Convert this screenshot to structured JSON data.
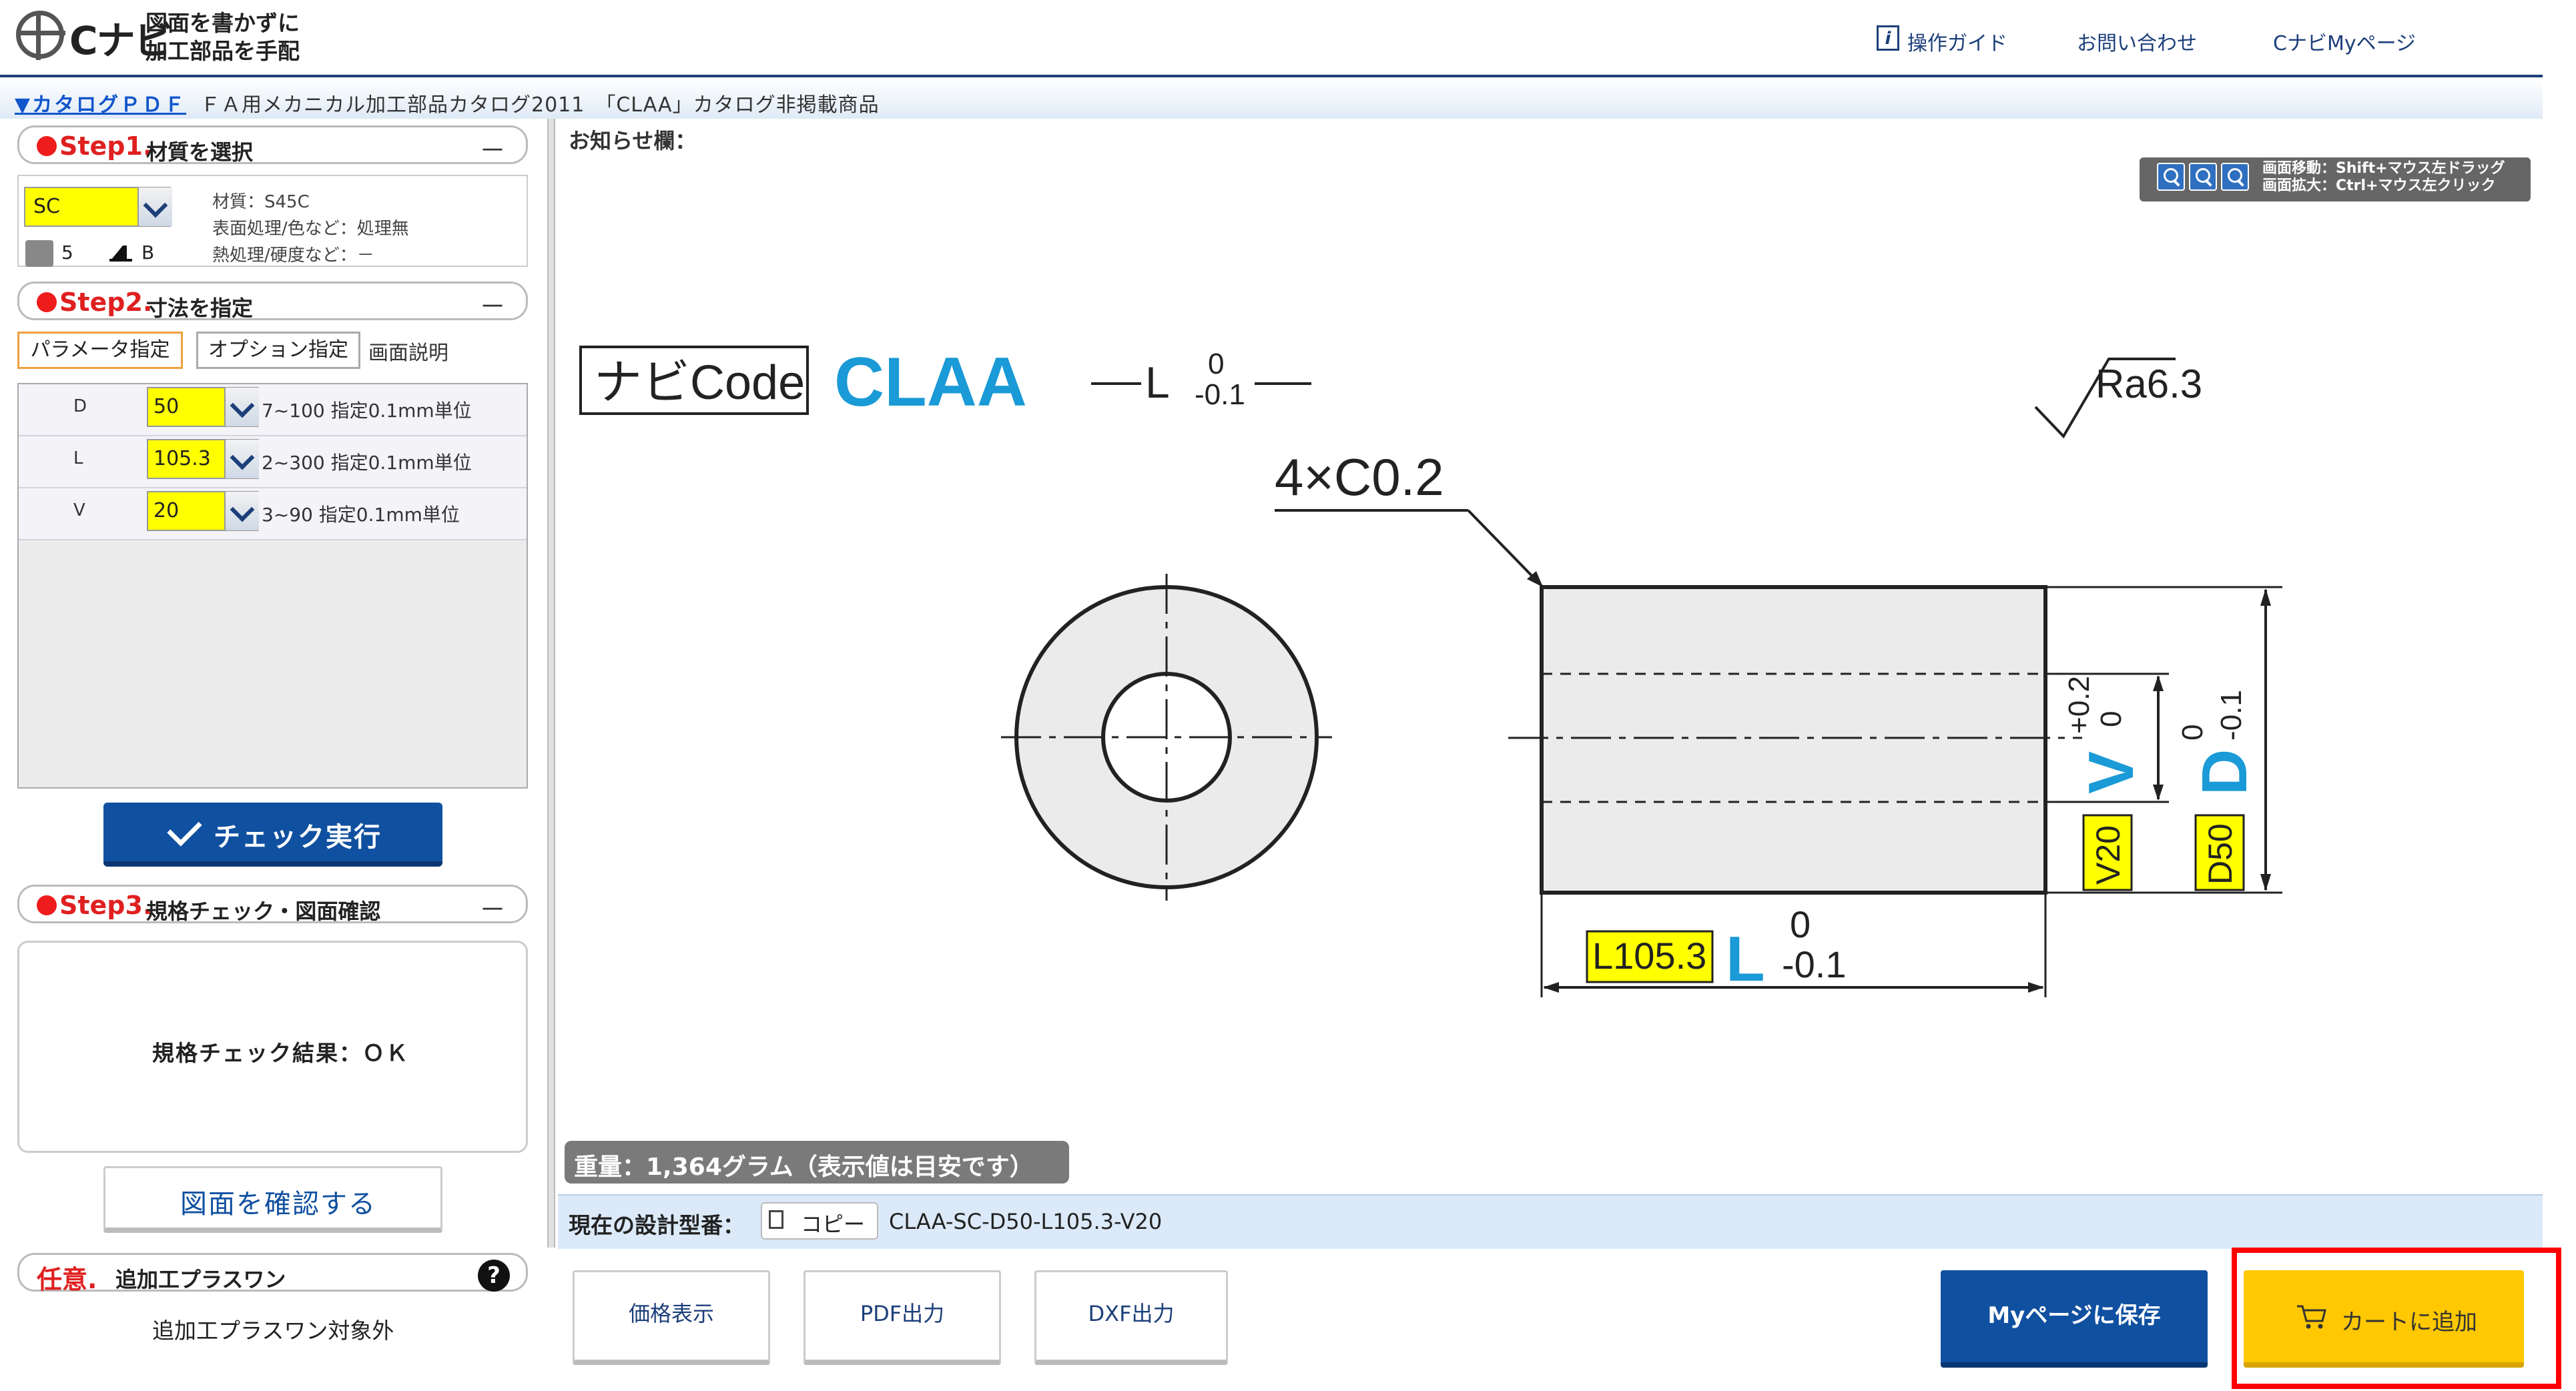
{
  "header": {
    "logo_text": "Cナビ",
    "tagline_line1": "図面を書かずに",
    "tagline_line2": "加工部品を手配",
    "links": [
      {
        "label": "操作ガイド",
        "icon": "info-icon"
      },
      {
        "label": "お問い合わせ"
      },
      {
        "label": "CナビMyページ"
      }
    ],
    "guide_icon_char": "i"
  },
  "catalog": {
    "link_label": "▼カタログＰＤＦ",
    "text": "ＦＡ用メカニカル加工部品カタログ2011　「CLAA」カタログ非掲載商品"
  },
  "step1": {
    "number": "Step1.",
    "title": "材質を選択",
    "collapse": "－",
    "material_value": "SC",
    "specs": [
      "材質：S45C",
      "表面処理/色など：処理無",
      "熱処理/硬度など：－"
    ],
    "ship_value": "5",
    "rank_value": "B"
  },
  "step2": {
    "number": "Step2.",
    "title": "寸法を指定",
    "collapse": "－",
    "tabs": [
      "パラメータ指定",
      "オプション指定"
    ],
    "screen_desc": "画面説明",
    "params": [
      {
        "label": "D",
        "value": "50",
        "desc": "7~100 指定0.1mm単位"
      },
      {
        "label": "L",
        "value": "105.3",
        "desc": "2~300 指定0.1mm単位"
      },
      {
        "label": "V",
        "value": "20",
        "desc": "3~90 指定0.1mm単位"
      }
    ],
    "check_button": "チェック実行"
  },
  "step3": {
    "number": "Step3.",
    "title": "規格チェック・図面確認",
    "collapse": "－",
    "result": "規格チェック結果：ＯＫ",
    "confirm_button": "図面を確認する"
  },
  "optional": {
    "number": "任意.",
    "title": "追加工プラスワン",
    "help": "?",
    "note": "追加工プラスワン対象外"
  },
  "notice_label": "お知らせ欄：",
  "zoom_hint_line1": "画面移動：Shift+マウス左ドラッグ",
  "zoom_hint_line2": "画面拡大：Ctrl+マウス左クリック",
  "drawing": {
    "navi_code_label": "ナビCode",
    "product_code": "CLAA",
    "l_tol_top": "0",
    "l_tol_bottom": "-0.1",
    "chamfer": "4×C0.2",
    "roughness": "Ra6.3",
    "v_tol_top": "+0.2",
    "v_tol_bottom": "0",
    "d_tol_top": "0",
    "d_tol_bottom": "-0.1",
    "l_value_box": "L105.3",
    "v_value_box": "V20",
    "d_value_box": "D50",
    "l_letter": "L",
    "v_letter": "V",
    "d_letter": "D",
    "accent_color": "#1a9ad6",
    "highlight_color": "#ffff00"
  },
  "weight": "重量：1,364グラム（表示値は目安です）",
  "part_number": {
    "label": "現在の設計型番：",
    "copy_label": "コピー",
    "code": "CLAA-SC-D50-L105.3-V20"
  },
  "buttons": {
    "price": "価格表示",
    "pdf": "PDF出力",
    "dxf": "DXF出力",
    "save": "Myページに保存",
    "cart": "カートに追加"
  }
}
